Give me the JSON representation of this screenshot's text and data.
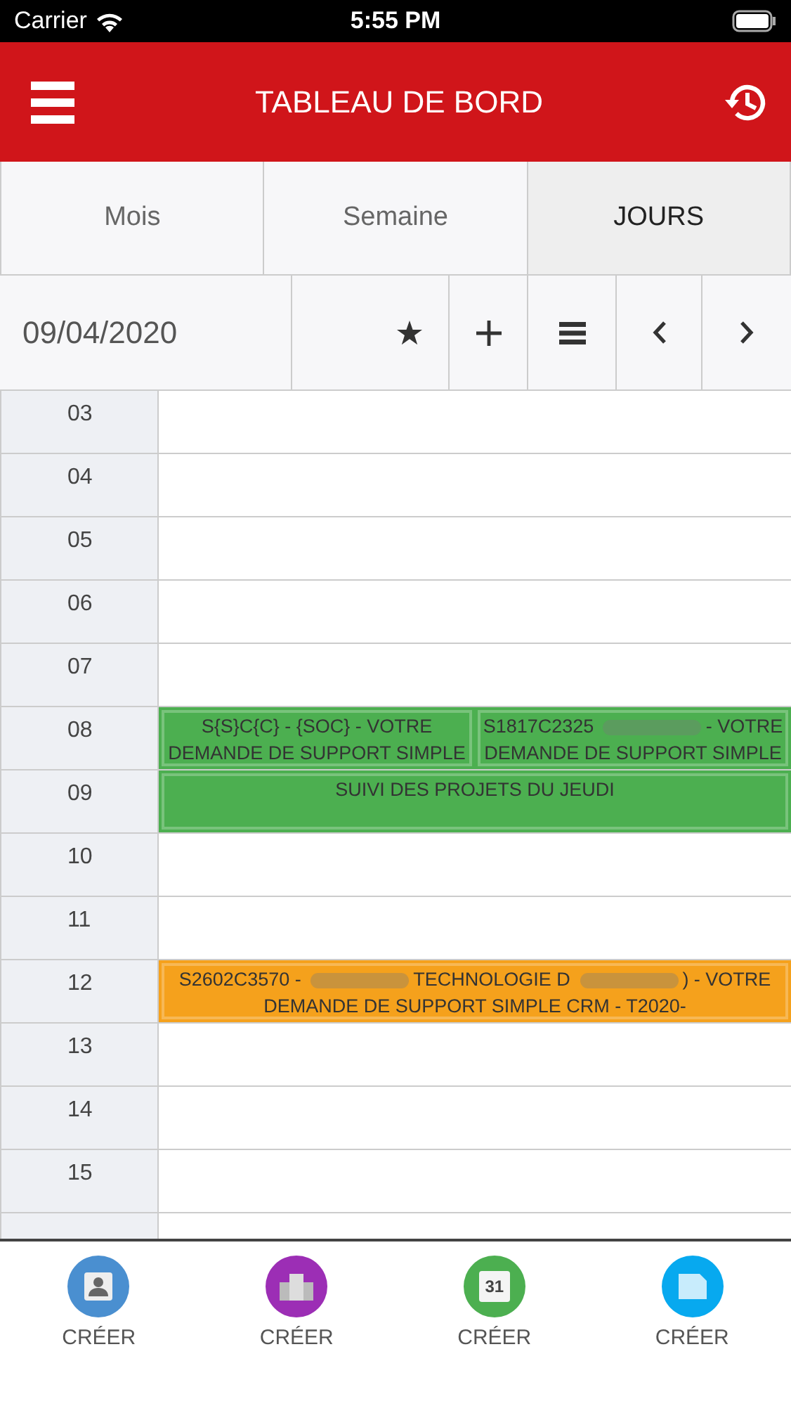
{
  "status_bar": {
    "carrier": "Carrier",
    "time": "5:55 PM"
  },
  "header": {
    "title": "TABLEAU DE BORD"
  },
  "tabs": [
    {
      "label": "Mois",
      "selected": false
    },
    {
      "label": "Semaine",
      "selected": false
    },
    {
      "label": "JOURS",
      "selected": true
    }
  ],
  "toolbar": {
    "date": "09/04/2020"
  },
  "hours": [
    {
      "label": "03"
    },
    {
      "label": "04"
    },
    {
      "label": "05"
    },
    {
      "label": "06"
    },
    {
      "label": "07"
    },
    {
      "label": "08",
      "events": [
        {
          "color": "#4caf50",
          "segments": [
            {
              "kind": "text",
              "text": "S{S}C{C} - {SOC} - VOTRE DEMANDE DE SUPPORT SIMPLE"
            }
          ]
        },
        {
          "color": "#4caf50",
          "segments": [
            {
              "kind": "text",
              "text": "S1817C2325"
            },
            {
              "kind": "redacted"
            },
            {
              "kind": "text",
              "text": "- VOTRE DEMANDE DE SUPPORT SIMPLE"
            }
          ]
        }
      ]
    },
    {
      "label": "09",
      "events": [
        {
          "color": "#4caf50",
          "segments": [
            {
              "kind": "text",
              "text": "SUIVI DES PROJETS DU JEUDI"
            }
          ]
        }
      ]
    },
    {
      "label": "10"
    },
    {
      "label": "11"
    },
    {
      "label": "12",
      "events": [
        {
          "color": "#f5a11c",
          "segments": [
            {
              "kind": "text",
              "text": "S2602C3570 -"
            },
            {
              "kind": "redacted"
            },
            {
              "kind": "text",
              "text": "TECHNOLOGIE D"
            },
            {
              "kind": "redacted"
            },
            {
              "kind": "text",
              "text": ") - VOTRE DEMANDE DE SUPPORT SIMPLE CRM - T2020-"
            }
          ]
        }
      ]
    },
    {
      "label": "13"
    },
    {
      "label": "14"
    },
    {
      "label": "15"
    }
  ],
  "bottom_bar": [
    {
      "kind": "contact",
      "label": "CRÉER",
      "color": "#4a8fd0"
    },
    {
      "kind": "company",
      "label": "CRÉER",
      "color": "#9c2eb5"
    },
    {
      "kind": "calendar",
      "label": "CRÉER",
      "color": "#4caf50",
      "icon_text": "31"
    },
    {
      "kind": "document",
      "label": "CRÉER",
      "color": "#07a9ef"
    }
  ]
}
